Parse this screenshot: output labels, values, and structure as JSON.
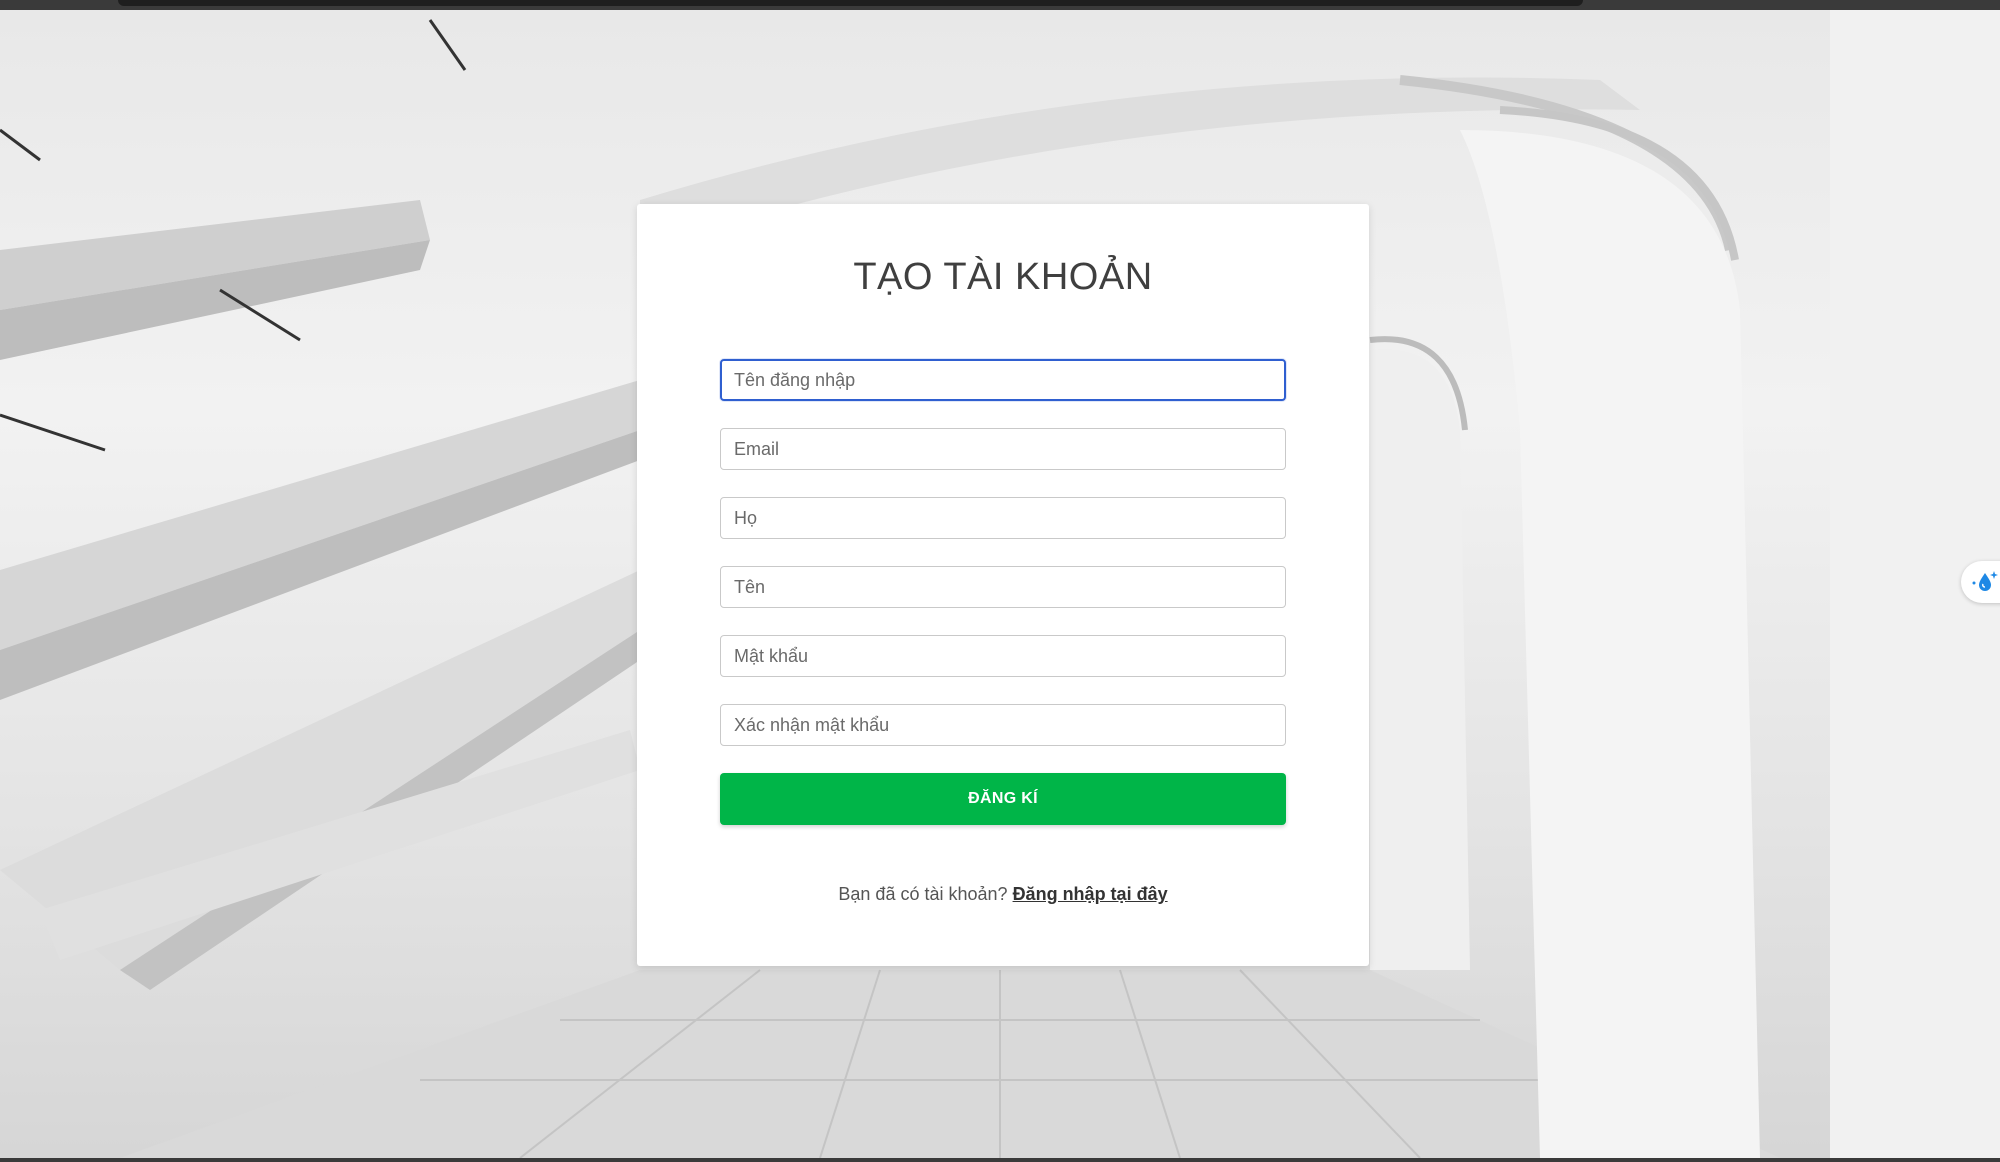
{
  "register_form": {
    "title": "TẠO TÀI KHOẢN",
    "fields": [
      {
        "placeholder": "Tên đăng nhập",
        "value": ""
      },
      {
        "placeholder": "Email",
        "value": ""
      },
      {
        "placeholder": "Họ",
        "value": ""
      },
      {
        "placeholder": "Tên",
        "value": ""
      },
      {
        "placeholder": "Mật khẩu",
        "value": ""
      },
      {
        "placeholder": "Xác nhận mật khẩu",
        "value": ""
      }
    ],
    "submit_label": "ĐĂNG KÍ",
    "login_prompt": "Bạn đã có tài khoản?",
    "login_link": "Đăng nhập tại đây"
  },
  "side_widget": {
    "icon": "water-drop-sparkle-icon"
  },
  "colors": {
    "submit_bg": "#00b548",
    "focus_border": "#2f5fd0",
    "card_bg": "#ffffff"
  }
}
